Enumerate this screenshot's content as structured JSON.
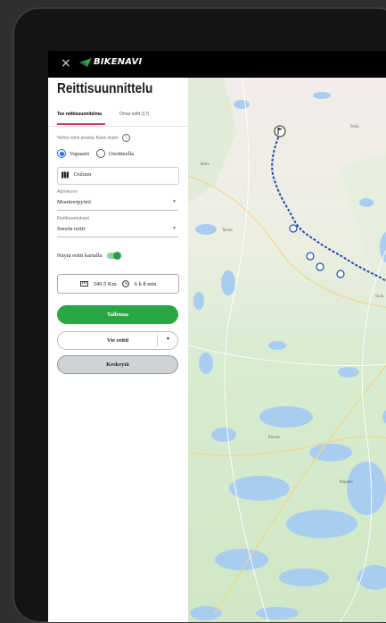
{
  "app": {
    "brand": "BIKENAVI",
    "close_symbol": "×"
  },
  "panel": {
    "title": "Reittisuunnittelu",
    "tabs": [
      {
        "label": "Tee reittisuunnitelma",
        "active": true
      },
      {
        "label": "Omat reitit (17)",
        "active": false
      }
    ],
    "hint": "Valitse reitin pisteitä. Katso ohjeet",
    "hint_icon": "info-icon",
    "modes": [
      {
        "label": "Vapaasti",
        "selected": true
      },
      {
        "label": "Osoitteella",
        "selected": false
      }
    ],
    "search": {
      "value": "Ouluun",
      "icon": "map-icon"
    },
    "vehicle": {
      "label": "Ajoneuvo",
      "value": "Moottoripyörä"
    },
    "route_settings": {
      "label": "Reittiasetukset",
      "value": "Suorin reitti"
    },
    "show_route": {
      "label": "Näytä reitti kartalla",
      "on": true
    },
    "stats": {
      "distance": "349.5 Km",
      "duration": "6 h 8 min"
    },
    "buttons": {
      "save": "Tallenna",
      "export": "Vie reitti",
      "cancel": "Keskeytä"
    }
  },
  "map": {
    "places": [
      "Pello",
      "Kemi",
      "Tornio",
      "Oulu",
      "Kajaani",
      "Ranua"
    ]
  },
  "colors": {
    "accent_green": "#28a745",
    "tab_underline": "#d9366b",
    "radio_blue": "#1a73e8",
    "route_blue": "#1f4aa8"
  }
}
